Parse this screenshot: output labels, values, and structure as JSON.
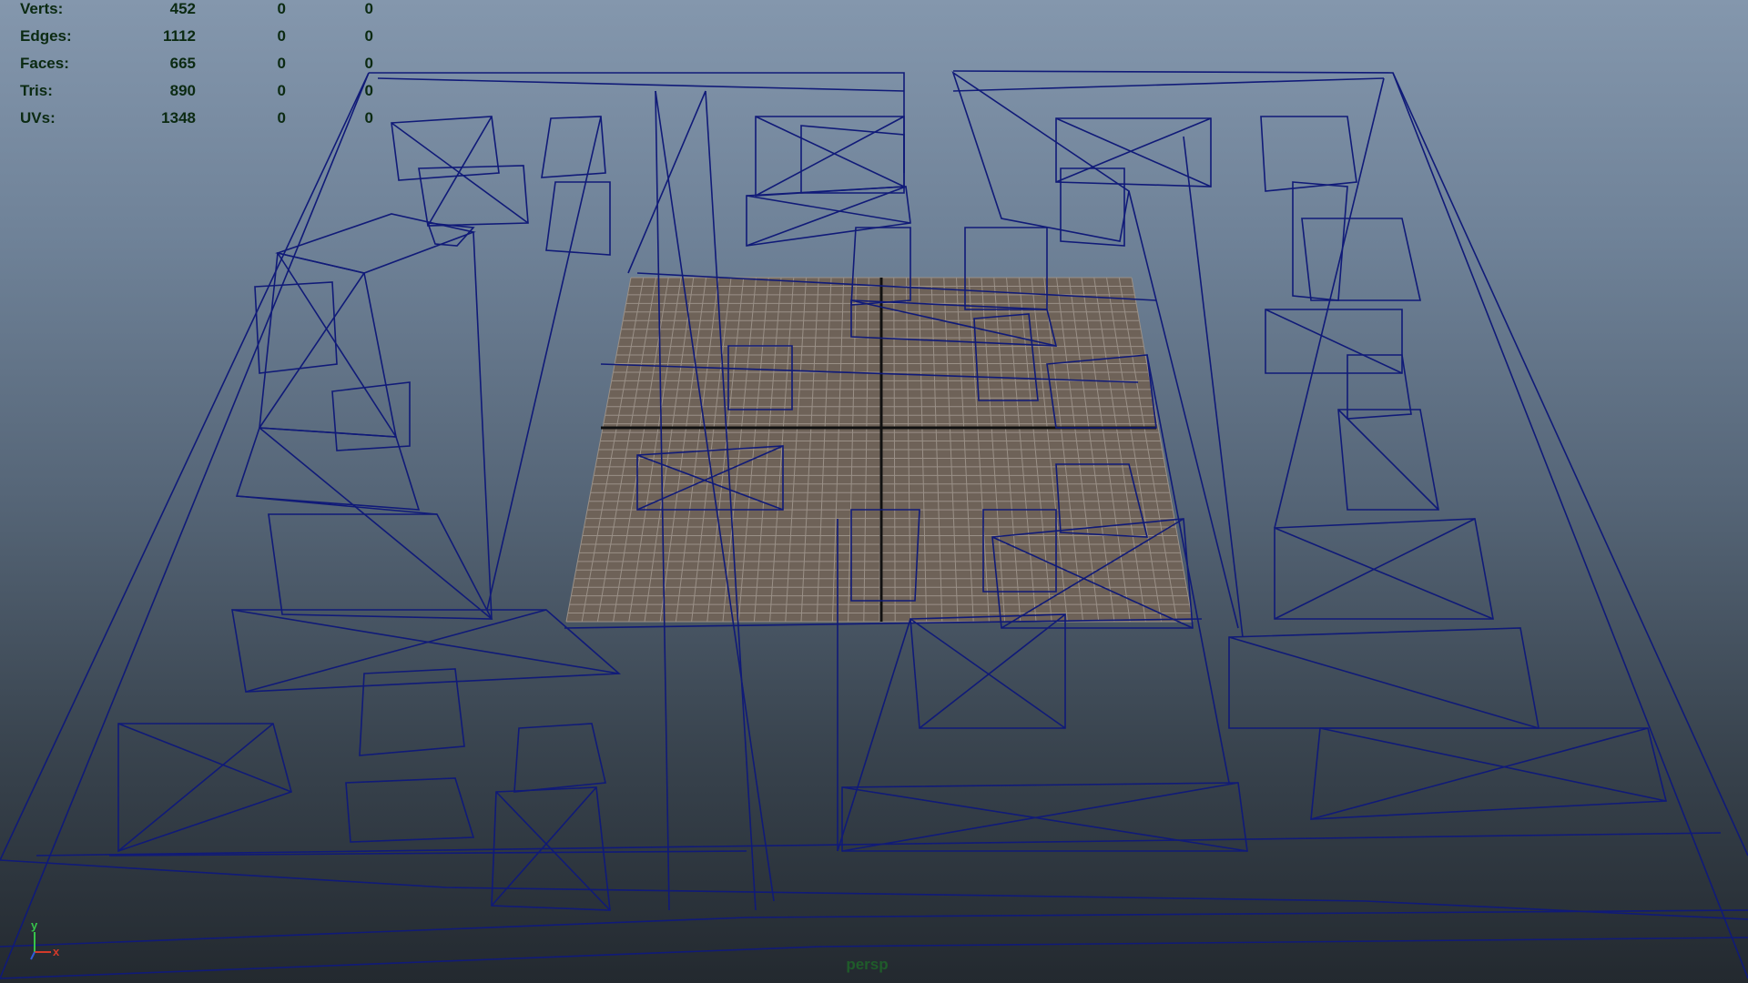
{
  "hud": {
    "rows": [
      {
        "label": "Verts:",
        "values": [
          "452",
          "0",
          "0"
        ]
      },
      {
        "label": "Edges:",
        "values": [
          "1112",
          "0",
          "0"
        ]
      },
      {
        "label": "Faces:",
        "values": [
          "665",
          "0",
          "0"
        ]
      },
      {
        "label": "Tris:",
        "values": [
          "890",
          "0",
          "0"
        ]
      },
      {
        "label": "UVs:",
        "values": [
          "1348",
          "0",
          "0"
        ]
      }
    ]
  },
  "viewport": {
    "camera_name": "persp",
    "wire_color": "#101a78",
    "grid_color": "#8a8178",
    "axis_labels": {
      "y": "y",
      "x": "x"
    },
    "axis_colors": {
      "x": "#d23a2a",
      "y": "#36c44a",
      "z": "#2f5cd9"
    }
  }
}
